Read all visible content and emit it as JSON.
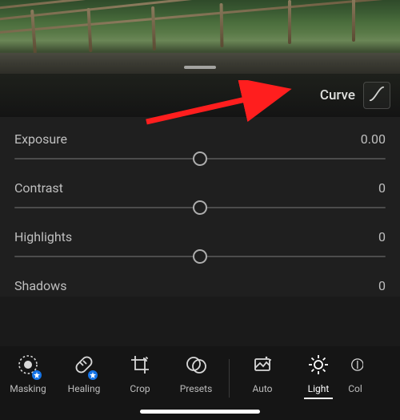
{
  "panel": {
    "curve_label": "Curve"
  },
  "sliders": {
    "exposure": {
      "label": "Exposure",
      "value": "0.00"
    },
    "contrast": {
      "label": "Contrast",
      "value": "0"
    },
    "highlights": {
      "label": "Highlights",
      "value": "0"
    },
    "shadows": {
      "label": "Shadows",
      "value": "0"
    }
  },
  "toolbar": {
    "masking": "Masking",
    "healing": "Healing",
    "crop": "Crop",
    "presets": "Presets",
    "auto": "Auto",
    "light": "Light",
    "color": "Col"
  },
  "annotation": {
    "arrow_color": "#ff1e1e"
  }
}
